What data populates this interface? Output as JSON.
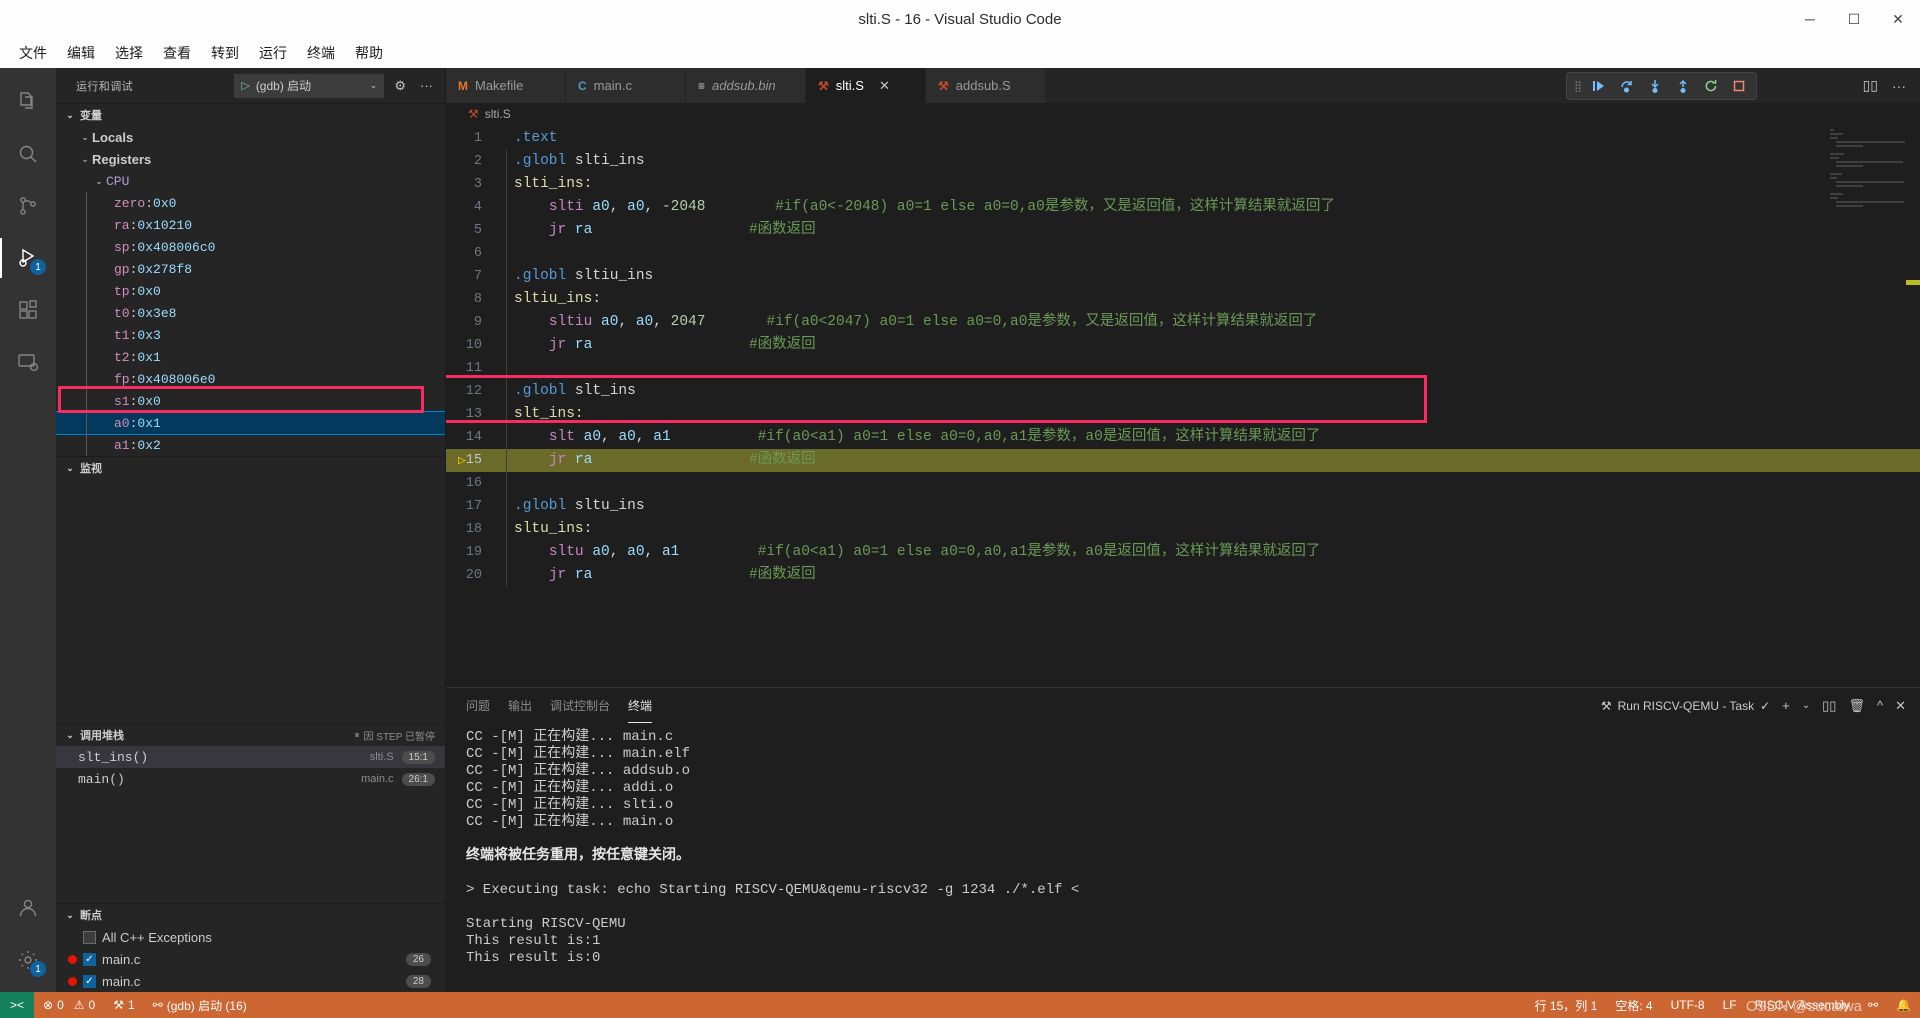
{
  "window": {
    "title": "slti.S - 16 - Visual Studio Code",
    "minimize": "─",
    "maximize": "☐",
    "close": "✕"
  },
  "menubar": [
    "文件",
    "编辑",
    "选择",
    "查看",
    "转到",
    "运行",
    "终端",
    "帮助"
  ],
  "activitybar": {
    "items": [
      {
        "name": "explorer-icon",
        "label": "资源管理器"
      },
      {
        "name": "search-icon",
        "label": "搜索"
      },
      {
        "name": "source-control-icon",
        "label": "源代码管理"
      },
      {
        "name": "run-debug-icon",
        "label": "运行和调试",
        "badge": "1",
        "active": true
      },
      {
        "name": "extensions-icon",
        "label": "扩展"
      },
      {
        "name": "remote-explorer-icon",
        "label": "远程资源管理器"
      }
    ],
    "bottom": [
      {
        "name": "account-icon",
        "label": "账户"
      },
      {
        "name": "settings-gear-icon",
        "label": "管理",
        "badge": "1"
      }
    ]
  },
  "sidebar": {
    "title": "运行和调试",
    "config": {
      "play_icon": "▷",
      "label": "(gdb) 启动",
      "chevron": "⌄"
    },
    "gear_icon": "⚙",
    "more_icon": "···",
    "variables": {
      "title": "变量",
      "twisty": "⌄",
      "groups": [
        {
          "label": "Locals",
          "twisty": "⌄",
          "indent": 1,
          "kind": "group"
        },
        {
          "label": "Registers",
          "twisty": "⌄",
          "indent": 1,
          "kind": "group"
        },
        {
          "label": "CPU",
          "twisty": "⌄",
          "indent": 2,
          "kind": "cpu"
        }
      ],
      "registers": [
        {
          "name": "zero",
          "value": "0x0"
        },
        {
          "name": "ra",
          "value": "0x10210"
        },
        {
          "name": "sp",
          "value": "0x408006c0"
        },
        {
          "name": "gp",
          "value": "0x278f8"
        },
        {
          "name": "tp",
          "value": "0x0"
        },
        {
          "name": "t0",
          "value": "0x3e8"
        },
        {
          "name": "t1",
          "value": "0x3"
        },
        {
          "name": "t2",
          "value": "0x1"
        },
        {
          "name": "fp",
          "value": "0x408006e0"
        },
        {
          "name": "s1",
          "value": "0x0"
        },
        {
          "name": "a0",
          "value": "0x1",
          "selected": true
        },
        {
          "name": "a1",
          "value": "0x2"
        }
      ]
    },
    "watch": {
      "title": "监视",
      "twisty": "⌄"
    },
    "callstack": {
      "title": "调用堆栈",
      "twisty": "⌄",
      "status": "因 STEP 已暂停",
      "status_icon": "⏸",
      "frames": [
        {
          "name": "slt_ins()",
          "file": "slti.S",
          "line": "15:1",
          "active": true
        },
        {
          "name": "main()",
          "file": "main.c",
          "line": "26:1",
          "active": false
        }
      ]
    },
    "breakpoints": {
      "title": "断点",
      "twisty": "⌄",
      "items": [
        {
          "label": "All C++ Exceptions",
          "checked": false,
          "has_dot": false,
          "line": ""
        },
        {
          "label": "main.c",
          "checked": true,
          "has_dot": true,
          "line": "26"
        },
        {
          "label": "main.c",
          "checked": true,
          "has_dot": true,
          "line": "28"
        }
      ]
    }
  },
  "editor": {
    "tabs": [
      {
        "label": "Makefile",
        "icon": "M",
        "icon_color": "#e37933",
        "active": false,
        "italic": false,
        "closable": false
      },
      {
        "label": "main.c",
        "icon": "C",
        "icon_color": "#519aba",
        "active": false,
        "italic": false,
        "closable": false
      },
      {
        "label": "addsub.bin",
        "icon": "≡",
        "icon_color": "#cccccc",
        "active": false,
        "italic": true,
        "closable": false
      },
      {
        "label": "slti.S",
        "icon": "⚒",
        "icon_color": "#c34b29",
        "active": true,
        "italic": false,
        "closable": true,
        "close": "✕"
      },
      {
        "label": "addsub.S",
        "icon": "⚒",
        "icon_color": "#c34b29",
        "active": false,
        "italic": false,
        "closable": false
      }
    ],
    "tabbar_actions": [
      {
        "name": "split-editor-icon",
        "glyph": "▯▯"
      },
      {
        "name": "more-actions-icon",
        "glyph": "···"
      }
    ],
    "debug_toolbar": [
      {
        "name": "continue-button",
        "title": "继续"
      },
      {
        "name": "step-over-button",
        "title": "单步跳过"
      },
      {
        "name": "step-into-button",
        "title": "单步调试"
      },
      {
        "name": "step-out-button",
        "title": "单步跳出"
      },
      {
        "name": "restart-button",
        "title": "重启"
      },
      {
        "name": "stop-button",
        "title": "停止"
      }
    ],
    "breadcrumb": {
      "icon": "⚒",
      "label": "slti.S"
    },
    "current_line": 15,
    "lines": [
      {
        "n": 1,
        "tokens": [
          {
            "t": ".text",
            "c": "dir"
          }
        ]
      },
      {
        "n": 2,
        "tokens": [
          {
            "t": ".globl ",
            "c": "dir"
          },
          {
            "t": "slti_ins",
            "c": "pln"
          }
        ]
      },
      {
        "n": 3,
        "tokens": [
          {
            "t": "slti_ins:",
            "c": "label"
          }
        ]
      },
      {
        "n": 4,
        "tokens": [
          {
            "t": "    ",
            "c": "pln"
          },
          {
            "t": "slti",
            "c": "ins"
          },
          {
            "t": " ",
            "c": "pln"
          },
          {
            "t": "a0",
            "c": "reg"
          },
          {
            "t": ", ",
            "c": "pln"
          },
          {
            "t": "a0",
            "c": "reg"
          },
          {
            "t": ", ",
            "c": "pln"
          },
          {
            "t": "-2048",
            "c": "num"
          },
          {
            "t": "        ",
            "c": "pln"
          },
          {
            "t": "#if(a0<-2048) a0=1 else a0=0,a0是参数，又是返回值，这样计算结果就返回了",
            "c": "cmt"
          }
        ]
      },
      {
        "n": 5,
        "tokens": [
          {
            "t": "    ",
            "c": "pln"
          },
          {
            "t": "jr",
            "c": "ins"
          },
          {
            "t": " ",
            "c": "pln"
          },
          {
            "t": "ra",
            "c": "reg"
          },
          {
            "t": "                  ",
            "c": "pln"
          },
          {
            "t": "#函数返回",
            "c": "cmt"
          }
        ]
      },
      {
        "n": 6,
        "tokens": []
      },
      {
        "n": 7,
        "tokens": [
          {
            "t": ".globl ",
            "c": "dir"
          },
          {
            "t": "sltiu_ins",
            "c": "pln"
          }
        ]
      },
      {
        "n": 8,
        "tokens": [
          {
            "t": "sltiu_ins:",
            "c": "label"
          }
        ]
      },
      {
        "n": 9,
        "tokens": [
          {
            "t": "    ",
            "c": "pln"
          },
          {
            "t": "sltiu",
            "c": "ins"
          },
          {
            "t": " ",
            "c": "pln"
          },
          {
            "t": "a0",
            "c": "reg"
          },
          {
            "t": ", ",
            "c": "pln"
          },
          {
            "t": "a0",
            "c": "reg"
          },
          {
            "t": ", ",
            "c": "pln"
          },
          {
            "t": "2047",
            "c": "num"
          },
          {
            "t": "       ",
            "c": "pln"
          },
          {
            "t": "#if(a0<2047) a0=1 else a0=0,a0是参数，又是返回值，这样计算结果就返回了",
            "c": "cmt"
          }
        ]
      },
      {
        "n": 10,
        "tokens": [
          {
            "t": "    ",
            "c": "pln"
          },
          {
            "t": "jr",
            "c": "ins"
          },
          {
            "t": " ",
            "c": "pln"
          },
          {
            "t": "ra",
            "c": "reg"
          },
          {
            "t": "                  ",
            "c": "pln"
          },
          {
            "t": "#函数返回",
            "c": "cmt"
          }
        ]
      },
      {
        "n": 11,
        "tokens": []
      },
      {
        "n": 12,
        "tokens": [
          {
            "t": ".globl ",
            "c": "dir"
          },
          {
            "t": "slt_ins",
            "c": "pln"
          }
        ]
      },
      {
        "n": 13,
        "tokens": [
          {
            "t": "slt_ins:",
            "c": "label"
          }
        ]
      },
      {
        "n": 14,
        "tokens": [
          {
            "t": "    ",
            "c": "pln"
          },
          {
            "t": "slt",
            "c": "ins"
          },
          {
            "t": " ",
            "c": "pln"
          },
          {
            "t": "a0",
            "c": "reg"
          },
          {
            "t": ", ",
            "c": "pln"
          },
          {
            "t": "a0",
            "c": "reg"
          },
          {
            "t": ", ",
            "c": "pln"
          },
          {
            "t": "a1",
            "c": "reg"
          },
          {
            "t": "          ",
            "c": "pln"
          },
          {
            "t": "#if(a0<a1) a0=1 else a0=0,a0,a1是参数，a0是返回值，这样计算结果就返回了",
            "c": "cmt"
          }
        ]
      },
      {
        "n": 15,
        "tokens": [
          {
            "t": "    ",
            "c": "pln"
          },
          {
            "t": "jr",
            "c": "ins"
          },
          {
            "t": " ",
            "c": "pln"
          },
          {
            "t": "ra",
            "c": "reg"
          },
          {
            "t": "                  ",
            "c": "pln"
          },
          {
            "t": "#函数返回",
            "c": "cmt"
          }
        ]
      },
      {
        "n": 16,
        "tokens": []
      },
      {
        "n": 17,
        "tokens": [
          {
            "t": ".globl ",
            "c": "dir"
          },
          {
            "t": "sltu_ins",
            "c": "pln"
          }
        ]
      },
      {
        "n": 18,
        "tokens": [
          {
            "t": "sltu_ins:",
            "c": "label"
          }
        ]
      },
      {
        "n": 19,
        "tokens": [
          {
            "t": "    ",
            "c": "pln"
          },
          {
            "t": "sltu",
            "c": "ins"
          },
          {
            "t": " ",
            "c": "pln"
          },
          {
            "t": "a0",
            "c": "reg"
          },
          {
            "t": ", ",
            "c": "pln"
          },
          {
            "t": "a0",
            "c": "reg"
          },
          {
            "t": ", ",
            "c": "pln"
          },
          {
            "t": "a1",
            "c": "reg"
          },
          {
            "t": "         ",
            "c": "pln"
          },
          {
            "t": "#if(a0<a1) a0=1 else a0=0,a0,a1是参数，a0是返回值，这样计算结果就返回了",
            "c": "cmt"
          }
        ]
      },
      {
        "n": 20,
        "tokens": [
          {
            "t": "    ",
            "c": "pln"
          },
          {
            "t": "jr",
            "c": "ins"
          },
          {
            "t": " ",
            "c": "pln"
          },
          {
            "t": "ra",
            "c": "reg"
          },
          {
            "t": "                  ",
            "c": "pln"
          },
          {
            "t": "#函数返回",
            "c": "cmt"
          }
        ]
      }
    ]
  },
  "panel": {
    "tabs": [
      {
        "label": "问题",
        "active": false
      },
      {
        "label": "输出",
        "active": false
      },
      {
        "label": "调试控制台",
        "active": false
      },
      {
        "label": "终端",
        "active": true
      }
    ],
    "task": {
      "icon": "⚒",
      "label": "Run RISCV-QEMU - Task",
      "check": "✓"
    },
    "actions": [
      {
        "name": "new-terminal-icon",
        "glyph": "+"
      },
      {
        "name": "terminal-dropdown-icon",
        "glyph": "⌄"
      },
      {
        "name": "split-terminal-icon",
        "glyph": "▯▯"
      },
      {
        "name": "kill-terminal-icon",
        "glyph": "🗑"
      },
      {
        "name": "maximize-panel-icon",
        "glyph": "^"
      },
      {
        "name": "close-panel-icon",
        "glyph": "✕"
      }
    ],
    "terminal_lines": [
      {
        "text": "CC -[M] 正在构建... main.c",
        "bold": false
      },
      {
        "text": "CC -[M] 正在构建... main.elf",
        "bold": false
      },
      {
        "text": "CC -[M] 正在构建... addsub.o",
        "bold": false
      },
      {
        "text": "CC -[M] 正在构建... addi.o",
        "bold": false
      },
      {
        "text": "CC -[M] 正在构建... slti.o",
        "bold": false
      },
      {
        "text": "CC -[M] 正在构建... main.o",
        "bold": false
      },
      {
        "text": "",
        "bold": false
      },
      {
        "text": "终端将被任务重用，按任意键关闭。",
        "bold": true
      },
      {
        "text": "",
        "bold": false
      },
      {
        "text": "> Executing task: echo Starting RISCV-QEMU&qemu-riscv32 -g 1234 ./*.elf <",
        "bold": false
      },
      {
        "text": "",
        "bold": false
      },
      {
        "text": "Starting RISCV-QEMU",
        "bold": false
      },
      {
        "text": "This result is:1",
        "bold": false
      },
      {
        "text": "This result is:0",
        "bold": false
      }
    ]
  },
  "statusbar": {
    "remote_icon": "><",
    "left": [
      {
        "name": "problems-status",
        "icon": "⊗",
        "text": "0",
        "icon2": "⚠",
        "text2": "0"
      },
      {
        "name": "ports-status",
        "icon": "⚒",
        "text": "1"
      },
      {
        "name": "debug-session-status",
        "icon": "⚯",
        "text": "(gdb) 启动 (16)"
      }
    ],
    "right": [
      {
        "name": "cursor-position-status",
        "text": "行 15，列 1"
      },
      {
        "name": "indentation-status",
        "text": "空格: 4"
      },
      {
        "name": "encoding-status",
        "text": "UTF-8"
      },
      {
        "name": "eol-status",
        "text": "LF"
      },
      {
        "name": "language-mode-status",
        "text": "RISC-V Assembly"
      },
      {
        "name": "live-share-status",
        "text": "⚯"
      },
      {
        "name": "notifications-status",
        "text": "🔔"
      }
    ]
  },
  "watermark": "CSDN @sucaiwa"
}
